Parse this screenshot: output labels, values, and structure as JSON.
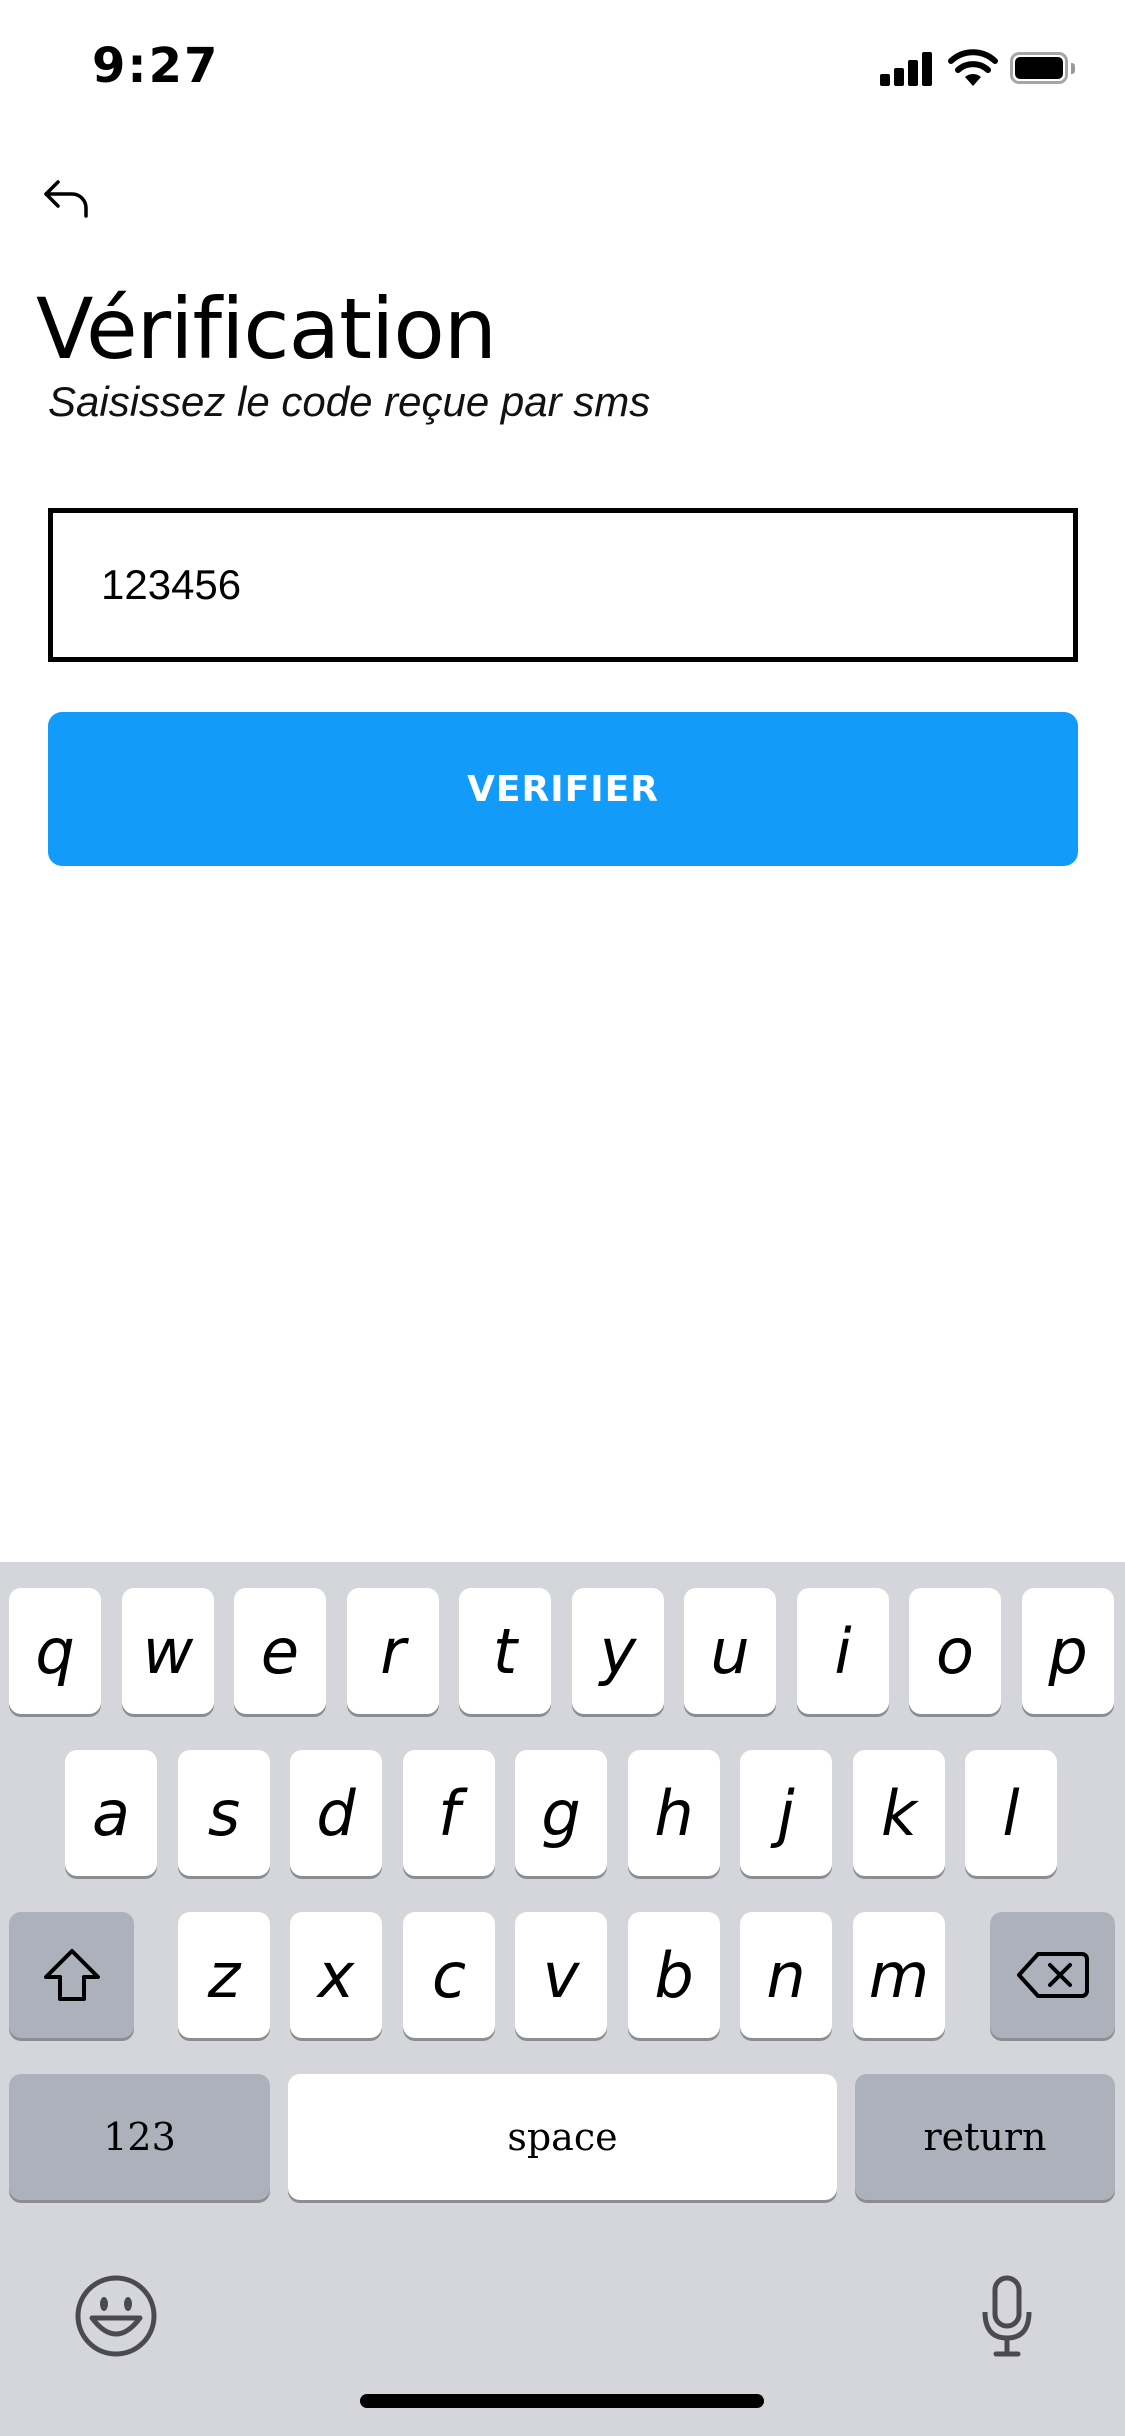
{
  "status_bar": {
    "time": "9:27"
  },
  "header": {
    "title": "Vérification",
    "subtitle": "Saisissez le code reçue par sms"
  },
  "form": {
    "code_value": "123456",
    "verify_label": "VERIFIER"
  },
  "keyboard": {
    "row1": [
      "q",
      "w",
      "e",
      "r",
      "t",
      "y",
      "u",
      "i",
      "o",
      "p"
    ],
    "row2": [
      "a",
      "s",
      "d",
      "f",
      "g",
      "h",
      "j",
      "k",
      "l"
    ],
    "row3": [
      "z",
      "x",
      "c",
      "v",
      "b",
      "n",
      "m"
    ],
    "numbers_label": "123",
    "space_label": "space",
    "return_label": "return"
  },
  "colors": {
    "accent": "#129bf9",
    "keyboard_bg": "#d5d6db",
    "key_dark": "#acb1bb"
  },
  "icons": [
    "back-arrow-icon",
    "signal-icon",
    "wifi-icon",
    "battery-icon",
    "shift-icon",
    "delete-icon",
    "emoji-icon",
    "microphone-icon"
  ]
}
